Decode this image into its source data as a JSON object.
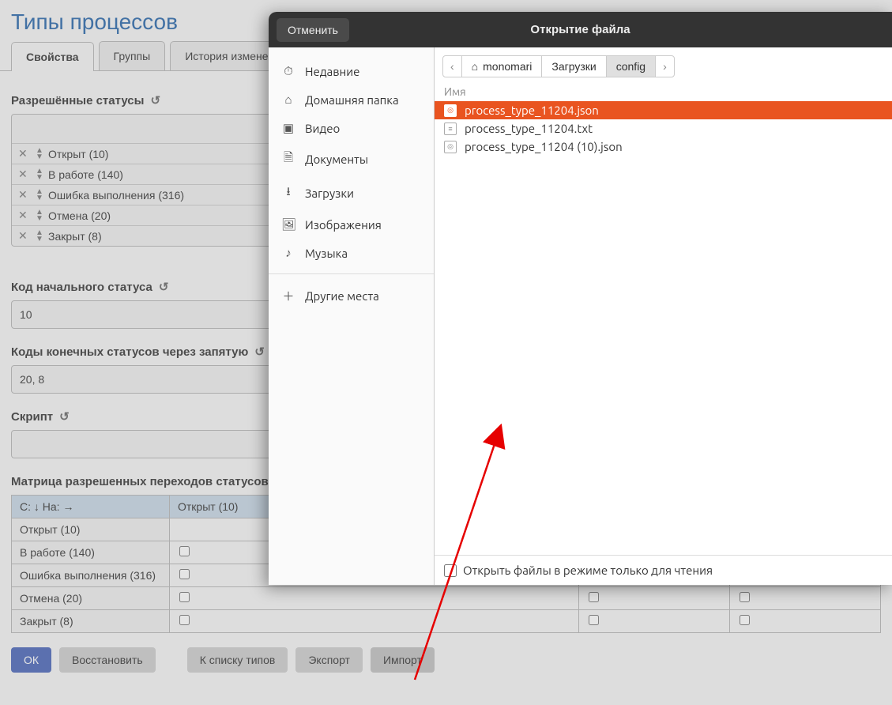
{
  "page": {
    "title": "Типы процессов"
  },
  "tabs": [
    {
      "label": "Свойства",
      "active": true
    },
    {
      "label": "Группы",
      "active": false
    },
    {
      "label": "История изменени",
      "active": false
    }
  ],
  "sections": {
    "allowed_statuses_label": "Разрешённые статусы",
    "initial_code_label": "Код начального статуса",
    "initial_code_value": "10",
    "final_codes_label": "Коды конечных статусов через запятую",
    "final_codes_value": "20, 8",
    "script_label": "Скрипт",
    "matrix_label": "Матрица разрешенных переходов статусов"
  },
  "statuses": [
    {
      "label": "Открыт (10)"
    },
    {
      "label": "В работе (140)"
    },
    {
      "label": "Ошибка выполнения (316)"
    },
    {
      "label": "Отмена (20)"
    },
    {
      "label": "Закрыт (8)"
    }
  ],
  "matrix": {
    "corner": "С: ↓ На: →",
    "col0": "Открыт (10)",
    "rows": [
      {
        "name": "Открыт (10)",
        "c0": false,
        "c1": false,
        "c2": false
      },
      {
        "name": "В работе (140)",
        "c0": false,
        "c1": false,
        "c2": false
      },
      {
        "name": "Ошибка выполнения (316)",
        "c0": false,
        "c1": true,
        "c2": false
      },
      {
        "name": "Отмена (20)",
        "c0": false,
        "c1": false,
        "c2": false
      },
      {
        "name": "Закрыт (8)",
        "c0": false,
        "c1": false,
        "c2": false
      }
    ]
  },
  "buttons": {
    "ok": "ОК",
    "restore": "Восстановить",
    "to_list": "К списку типов",
    "export": "Экспорт",
    "import": "Импорт"
  },
  "dialog": {
    "cancel": "Отменить",
    "title": "Открытие файла",
    "sidebar": [
      {
        "icon": "⏱",
        "label": "Недавние"
      },
      {
        "icon": "⌂",
        "label": "Домашняя папка"
      },
      {
        "icon": "▣",
        "label": "Видео"
      },
      {
        "icon": "🗎",
        "label": "Документы"
      },
      {
        "icon": "⭳",
        "label": "Загрузки"
      },
      {
        "icon": "🖼",
        "label": "Изображения"
      },
      {
        "icon": "♪",
        "label": "Музыка"
      },
      {
        "icon": "＋",
        "label": "Другие места"
      }
    ],
    "breadcrumb": {
      "back": "‹",
      "home_icon": "⌂",
      "seg1": "monomari",
      "seg2": "Загрузки",
      "seg3": "config",
      "forward": "›"
    },
    "list_header": "Имя",
    "files": [
      {
        "name": "process_type_11204.json",
        "selected": true
      },
      {
        "name": "process_type_11204.txt",
        "selected": false
      },
      {
        "name": "process_type_11204 (10).json",
        "selected": false
      }
    ],
    "readonly_label": "Открыть файлы в режиме только для чтения"
  }
}
